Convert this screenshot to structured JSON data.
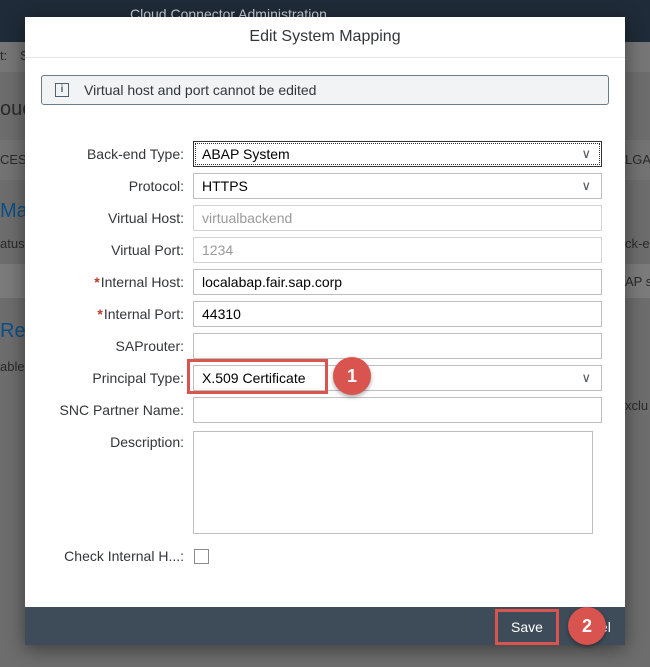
{
  "background": {
    "app_title": "Cloud Connector Administration",
    "frag_left_1": "t:",
    "frag_left_2": "S",
    "frag_heading_1": "ouc",
    "frag_tab": "CESS",
    "frag_heading_2": "Map",
    "frag_status": "atus",
    "frag_heading_3": "Reso",
    "frag_table": "able",
    "frag_right_tab": "LGAT",
    "frag_right_1": "ck-e",
    "frag_right_2": "AP s",
    "frag_right_3": "xclu"
  },
  "dialog": {
    "title": "Edit System Mapping",
    "info_text": "Virtual host and port cannot be edited",
    "info_icon": "info-icon",
    "fields": {
      "backend_type": {
        "label": "Back-end Type:",
        "value": "ABAP System"
      },
      "protocol": {
        "label": "Protocol:",
        "value": "HTTPS"
      },
      "virtual_host": {
        "label": "Virtual Host:",
        "value": "virtualbackend"
      },
      "virtual_port": {
        "label": "Virtual Port:",
        "value": "1234"
      },
      "internal_host": {
        "label": "Internal Host:",
        "value": "localabap.fair.sap.corp",
        "required": "*"
      },
      "internal_port": {
        "label": "Internal Port:",
        "value": "44310",
        "required": "*"
      },
      "saprouter": {
        "label": "SAProuter:",
        "value": ""
      },
      "principal_type": {
        "label": "Principal Type:",
        "value": "X.509 Certificate"
      },
      "snc_partner": {
        "label": "SNC Partner Name:",
        "value": ""
      },
      "description": {
        "label": "Description:",
        "value": ""
      },
      "check_internal_host": {
        "label": "Check Internal H...:",
        "checked": false
      }
    },
    "footer": {
      "save_label": "Save",
      "cancel_tail": "el"
    }
  },
  "annotations": {
    "badge_1": "1",
    "badge_2": "2",
    "highlight_color": "#d9534f"
  }
}
